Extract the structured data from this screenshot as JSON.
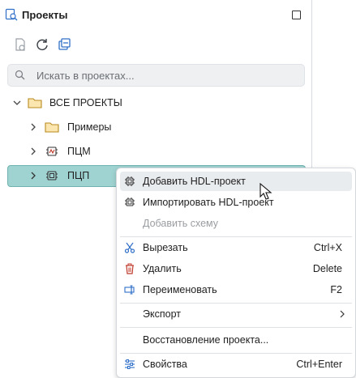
{
  "panel": {
    "title": "Проекты",
    "icon": "project-search-icon"
  },
  "toolbar": {
    "buttons": [
      "new-file-icon",
      "refresh-icon",
      "collapse-all-icon"
    ]
  },
  "search": {
    "placeholder": "Искать в проектах..."
  },
  "tree": {
    "items": [
      {
        "label": "ВСЕ ПРОЕКТЫ",
        "icon": "folder-icon",
        "expanded": true
      },
      {
        "label": "Примеры",
        "icon": "folder-icon",
        "expanded": false
      },
      {
        "label": "ПЦМ",
        "icon": "chip-analog-icon",
        "expanded": false
      },
      {
        "label": "ПЦП",
        "icon": "chip-digital-icon",
        "expanded": false,
        "selected": true
      }
    ]
  },
  "context_menu": {
    "items": [
      {
        "label": "Добавить HDL-проект",
        "icon": "chip-icon",
        "shortcut": "",
        "hover": true
      },
      {
        "label": "Импортировать HDL-проект",
        "icon": "chip-import-icon",
        "shortcut": ""
      },
      {
        "label": "Добавить схему",
        "icon": "",
        "shortcut": "",
        "disabled": true
      },
      {
        "label": "Вырезать",
        "icon": "scissors-icon",
        "shortcut": "Ctrl+X"
      },
      {
        "label": "Удалить",
        "icon": "trash-icon",
        "shortcut": "Delete"
      },
      {
        "label": "Переименовать",
        "icon": "rename-icon",
        "shortcut": "F2"
      },
      {
        "label": "Экспорт",
        "icon": "",
        "shortcut": "",
        "submenu": true
      },
      {
        "label": "Восстановление проекта...",
        "icon": "",
        "shortcut": ""
      },
      {
        "label": "Свойства",
        "icon": "settings-sliders-icon",
        "shortcut": "Ctrl+Enter"
      }
    ]
  },
  "colors": {
    "selection_bg": "#9fd3d1",
    "accent_blue": "#2f6fc8",
    "delete_red": "#c0392b",
    "folder_yellow": "#e6b43c"
  }
}
